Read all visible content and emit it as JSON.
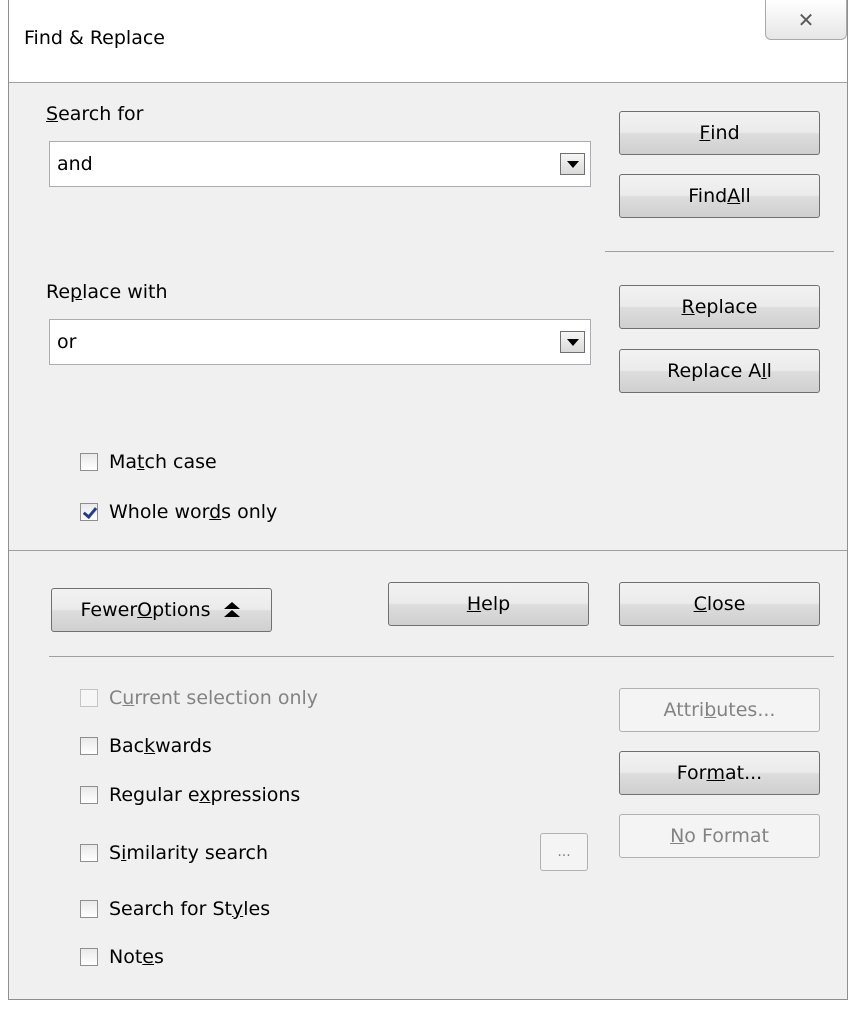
{
  "window": {
    "title": "Find & Replace",
    "close_glyph": "✕"
  },
  "search": {
    "label_pre": "",
    "label_key": "S",
    "label_post": "earch for",
    "value": "and"
  },
  "replace": {
    "label_pre": "Re",
    "label_key": "p",
    "label_post": "lace with",
    "value": "or"
  },
  "buttons": {
    "find": {
      "pre": "",
      "key": "F",
      "post": "ind"
    },
    "find_all": {
      "pre": "Find ",
      "key": "A",
      "post": "ll"
    },
    "replace": {
      "pre": "",
      "key": "R",
      "post": "eplace"
    },
    "replace_all": {
      "pre": "Replace A",
      "key": "l",
      "post": "l"
    },
    "fewer": {
      "pre": "Fewer ",
      "key": "O",
      "post": "ptions"
    },
    "help": {
      "pre": "",
      "key": "H",
      "post": "elp"
    },
    "close": {
      "pre": "",
      "key": "C",
      "post": "lose"
    },
    "attributes": {
      "pre": "Attri",
      "key": "b",
      "post": "utes..."
    },
    "format": {
      "pre": "For",
      "key": "m",
      "post": "at..."
    },
    "no_format": {
      "pre": "",
      "key": "N",
      "post": "o Format"
    },
    "similarity_dots": "..."
  },
  "options": {
    "match_case": {
      "pre": "Ma",
      "key": "t",
      "post": "ch case",
      "checked": false
    },
    "whole_words": {
      "pre": "Whole wor",
      "key": "d",
      "post": "s only",
      "checked": true
    },
    "current_sel": {
      "pre": "C",
      "key": "u",
      "post": "rrent selection only",
      "checked": false,
      "disabled": true
    },
    "backwards": {
      "pre": "Bac",
      "key": "k",
      "post": "wards",
      "checked": false
    },
    "regex": {
      "pre": "Regular e",
      "key": "x",
      "post": "pressions",
      "checked": false
    },
    "similarity": {
      "pre": "S",
      "key": "i",
      "post": "milarity search",
      "checked": false
    },
    "styles": {
      "pre": "Search for St",
      "key": "y",
      "post": "les",
      "checked": false
    },
    "notes": {
      "pre": "Not",
      "key": "e",
      "post": "s",
      "checked": false
    }
  },
  "icons": {
    "fewer_options": "double-chevron-up-icon"
  }
}
